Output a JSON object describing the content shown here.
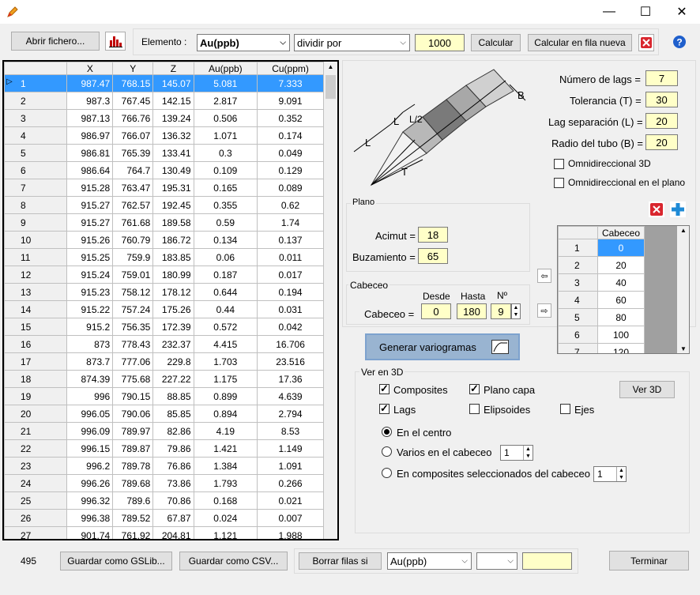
{
  "window": {
    "minimize": "—",
    "maximize": "☐",
    "close": "✕"
  },
  "toolbar": {
    "open_file": "Abrir fichero...",
    "element_label": "Elemento :",
    "element_value": "Au(ppb)",
    "operation_value": "dividir por",
    "factor_value": "1000",
    "calc": "Calcular",
    "calc_new_row": "Calcular en fila nueva"
  },
  "grid": {
    "headers": [
      "X",
      "Y",
      "Z",
      "Au(ppb)",
      "Cu(ppm)"
    ],
    "rows": [
      [
        "1",
        "987.47",
        "768.15",
        "145.07",
        "5.081",
        "7.333"
      ],
      [
        "2",
        "987.3",
        "767.45",
        "142.15",
        "2.817",
        "9.091"
      ],
      [
        "3",
        "987.13",
        "766.76",
        "139.24",
        "0.506",
        "0.352"
      ],
      [
        "4",
        "986.97",
        "766.07",
        "136.32",
        "1.071",
        "0.174"
      ],
      [
        "5",
        "986.81",
        "765.39",
        "133.41",
        "0.3",
        "0.049"
      ],
      [
        "6",
        "986.64",
        "764.7",
        "130.49",
        "0.109",
        "0.129"
      ],
      [
        "7",
        "915.28",
        "763.47",
        "195.31",
        "0.165",
        "0.089"
      ],
      [
        "8",
        "915.27",
        "762.57",
        "192.45",
        "0.355",
        "0.62"
      ],
      [
        "9",
        "915.27",
        "761.68",
        "189.58",
        "0.59",
        "1.74"
      ],
      [
        "10",
        "915.26",
        "760.79",
        "186.72",
        "0.134",
        "0.137"
      ],
      [
        "11",
        "915.25",
        "759.9",
        "183.85",
        "0.06",
        "0.011"
      ],
      [
        "12",
        "915.24",
        "759.01",
        "180.99",
        "0.187",
        "0.017"
      ],
      [
        "13",
        "915.23",
        "758.12",
        "178.12",
        "0.644",
        "0.194"
      ],
      [
        "14",
        "915.22",
        "757.24",
        "175.26",
        "0.44",
        "0.031"
      ],
      [
        "15",
        "915.2",
        "756.35",
        "172.39",
        "0.572",
        "0.042"
      ],
      [
        "16",
        "873",
        "778.43",
        "232.37",
        "4.415",
        "16.706"
      ],
      [
        "17",
        "873.7",
        "777.06",
        "229.8",
        "1.703",
        "23.516"
      ],
      [
        "18",
        "874.39",
        "775.68",
        "227.22",
        "1.175",
        "17.36"
      ],
      [
        "19",
        "996",
        "790.15",
        "88.85",
        "0.899",
        "4.639"
      ],
      [
        "20",
        "996.05",
        "790.06",
        "85.85",
        "0.894",
        "2.794"
      ],
      [
        "21",
        "996.09",
        "789.97",
        "82.86",
        "4.19",
        "8.53"
      ],
      [
        "22",
        "996.15",
        "789.87",
        "79.86",
        "1.421",
        "1.149"
      ],
      [
        "23",
        "996.2",
        "789.78",
        "76.86",
        "1.384",
        "1.091"
      ],
      [
        "24",
        "996.26",
        "789.68",
        "73.86",
        "1.793",
        "0.266"
      ],
      [
        "25",
        "996.32",
        "789.6",
        "70.86",
        "0.168",
        "0.021"
      ],
      [
        "26",
        "996.38",
        "789.52",
        "67.87",
        "0.024",
        "0.007"
      ],
      [
        "27",
        "901.74",
        "761.92",
        "204.81",
        "1.121",
        "1.988"
      ]
    ]
  },
  "params": {
    "lags_label": "Número de lags =",
    "lags": "7",
    "tol_label": "Tolerancia (T) =",
    "tol": "30",
    "sep_label": "Lag separación (L) =",
    "sep": "20",
    "radius_label": "Radio del tubo (B) =",
    "radius": "20",
    "omni3d": "Omnidireccional 3D",
    "omniplane": "Omnidireccional en el plano"
  },
  "diagram": {
    "L1": "L",
    "L2": "L",
    "L3": "L/2",
    "B": "B",
    "T": "T"
  },
  "plano": {
    "title": "Plano",
    "azimuth_label": "Acimut =",
    "azimuth": "18",
    "dip_label": "Buzamiento =",
    "dip": "65"
  },
  "cabeceo": {
    "title": "Cabeceo",
    "from_label": "Desde",
    "to_label": "Hasta",
    "n_label": "Nº",
    "label": "Cabeceo =",
    "from": "0",
    "to": "180",
    "n": "9"
  },
  "pitch_list": {
    "header": "Cabeceo",
    "rows": [
      [
        "1",
        "0"
      ],
      [
        "2",
        "20"
      ],
      [
        "3",
        "40"
      ],
      [
        "4",
        "60"
      ],
      [
        "5",
        "80"
      ],
      [
        "6",
        "100"
      ],
      [
        "7",
        "120"
      ]
    ]
  },
  "generate": "Generar variogramas",
  "view3d": {
    "title": "Ver en 3D",
    "composites": "Composites",
    "plano_capa": "Plano capa",
    "ver3d": "Ver 3D",
    "lags": "Lags",
    "elipsoides": "Elipsoides",
    "ejes": "Ejes",
    "center": "En el centro",
    "varios": "Varios en el cabeceo",
    "varios_n": "1",
    "selected": "En composites seleccionados del cabeceo",
    "selected_n": "1"
  },
  "bottom": {
    "count": "495",
    "save_gslib": "Guardar como GSLib...",
    "save_csv": "Guardar como CSV...",
    "delete_rows": "Borrar filas si",
    "filter_element": "Au(ppb)",
    "finish": "Terminar"
  },
  "colors": {
    "selection": "#3399ff",
    "input_yellow": "#ffffc8",
    "generate_bg": "#99b4d1"
  }
}
